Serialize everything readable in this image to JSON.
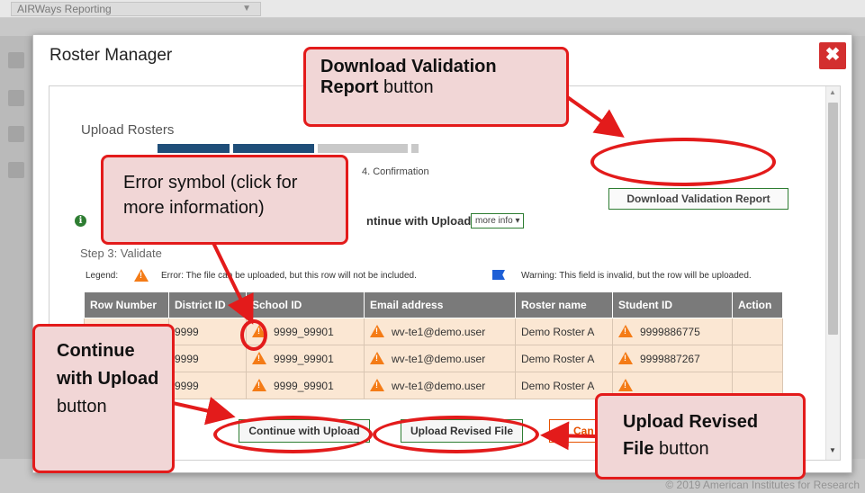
{
  "background": {
    "app_select_label": "AIRWays Reporting",
    "footer_text": "© 2019 American Institutes for Research"
  },
  "modal": {
    "title": "Roster Manager",
    "close_label": "✖",
    "section_title": "Upload Rosters",
    "step4_label": "4. Confirmation",
    "download_report_label": "Download Validation Report",
    "info_message": "ntinue with Upload.",
    "more_info_label": "more info ▾",
    "step3_label": "Step 3: Validate",
    "legend": {
      "label": "Legend:",
      "error_text": "Error: The file can be uploaded, but this row will not be included.",
      "warning_text": "Warning: This field is invalid, but the row will be uploaded."
    },
    "table": {
      "headers": [
        "Row Number",
        "District ID",
        "School ID",
        "Email address",
        "Roster name",
        "Student ID",
        "Action"
      ],
      "rows": [
        {
          "district_id": "9999",
          "school_id": "9999_99901",
          "email": "wv-te1@demo.user",
          "roster_name": "Demo Roster A",
          "student_id": "9999886775"
        },
        {
          "district_id": "9999",
          "school_id": "9999_99901",
          "email": "wv-te1@demo.user",
          "roster_name": "Demo Roster A",
          "student_id": "9999887267"
        },
        {
          "district_id": "9999",
          "school_id": "9999_99901",
          "email": "wv-te1@demo.user",
          "roster_name": "Demo Roster A",
          "student_id": ""
        }
      ]
    },
    "buttons": {
      "continue_label": "Continue with Upload",
      "upload_revised_label": "Upload Revised File",
      "cancel_label": "Can"
    }
  },
  "annotations": {
    "download_callout": {
      "bold": "Download Validation Report",
      "normal": " button"
    },
    "error_callout": "Error symbol (click for more information)",
    "continue_callout": {
      "bold": "Continue with Upload",
      "normal": "button"
    },
    "revised_callout": {
      "bold": "Upload Revised File",
      "normal": " button"
    }
  },
  "colors": {
    "annotation_red": "#e31b1b",
    "error_orange": "#f47b16",
    "warning_blue": "#1e5fd6",
    "primary_green": "#2e7d32"
  }
}
